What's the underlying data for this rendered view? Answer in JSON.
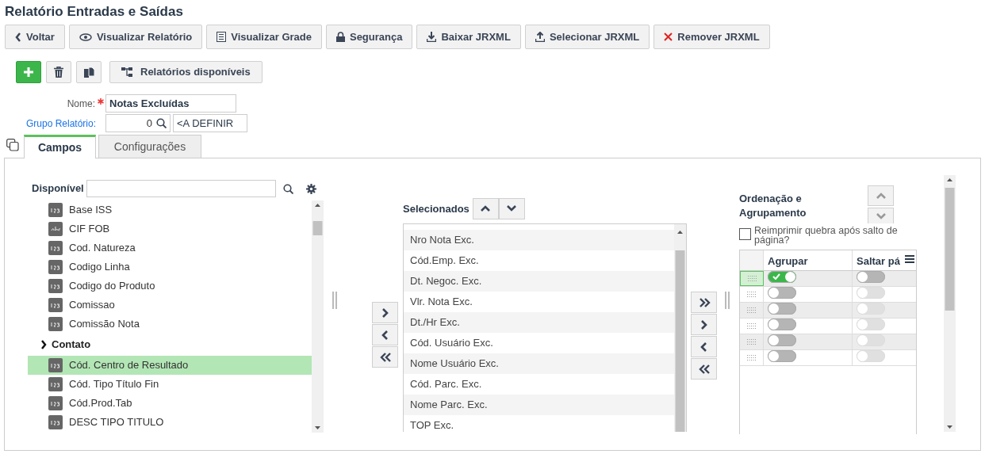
{
  "title": "Relatório Entradas e Saídas",
  "toolbar": [
    {
      "label": "Voltar"
    },
    {
      "label": "Visualizar Relatório"
    },
    {
      "label": "Visualizar Grade"
    },
    {
      "label": "Segurança"
    },
    {
      "label": "Baixar JRXML"
    },
    {
      "label": "Selecionar JRXML"
    },
    {
      "label": "Remover JRXML"
    }
  ],
  "reports_button": {
    "label": "Relatórios disponíveis"
  },
  "name_field": {
    "label": "Nome:",
    "required": true,
    "value": "Notas Excluídas"
  },
  "group_field": {
    "label": "Grupo Relatório:",
    "code": "0",
    "description": "<A DEFINIR"
  },
  "tabs": [
    {
      "label": "Campos",
      "selected": true
    },
    {
      "label": "Configurações",
      "selected": false
    }
  ],
  "available": {
    "label": "Disponível",
    "items": [
      {
        "label": "Base ISS",
        "kind": "number",
        "selected": false
      },
      {
        "label": "CIF FOB",
        "kind": "text",
        "selected": false
      },
      {
        "label": "Cod. Natureza",
        "kind": "number",
        "selected": false
      },
      {
        "label": "Codigo Linha",
        "kind": "number",
        "selected": false
      },
      {
        "label": "Codigo do Produto",
        "kind": "number",
        "selected": false
      },
      {
        "label": "Comissao",
        "kind": "number",
        "selected": false
      },
      {
        "label": "Comissão Nota",
        "kind": "number",
        "selected": false
      },
      {
        "label": "Contato",
        "kind": "group",
        "selected": false,
        "expanded": false
      },
      {
        "label": "Cód. Centro de Resultado",
        "kind": "number",
        "selected": true
      },
      {
        "label": "Cód. Tipo Título Fin",
        "kind": "number",
        "selected": false
      },
      {
        "label": "Cód.Prod.Tab",
        "kind": "number",
        "selected": false
      },
      {
        "label": "DESC TIPO TITULO",
        "kind": "number",
        "selected": false
      }
    ]
  },
  "selected_fields": {
    "label": "Selecionados",
    "items": [
      "Nro Nota Exc.",
      "Cód.Emp. Exc.",
      "Dt. Negoc. Exc.",
      "Vlr. Nota Exc.",
      "Dt./Hr Exc.",
      "Cód. Usuário Exc.",
      "Nome Usuário Exc.",
      "Cód. Parc. Exc.",
      "Nome Parc. Exc.",
      "TOP Exc."
    ]
  },
  "ordering": {
    "title": "Ordenação e Agrupamento",
    "reprint": {
      "label": "Reimprimir quebra após salto de página?",
      "checked": false
    },
    "columns": [
      "Agrupar",
      "Saltar pá"
    ],
    "rows": [
      {
        "selected": true,
        "group": true,
        "page_break": false,
        "break_disabled": false
      },
      {
        "selected": false,
        "group": false,
        "page_break": false,
        "break_disabled": true
      },
      {
        "selected": false,
        "group": false,
        "page_break": false,
        "break_disabled": true
      },
      {
        "selected": false,
        "group": false,
        "page_break": false,
        "break_disabled": true
      },
      {
        "selected": false,
        "group": false,
        "page_break": false,
        "break_disabled": true
      },
      {
        "selected": false,
        "group": false,
        "page_break": false,
        "break_disabled": true
      }
    ]
  }
}
